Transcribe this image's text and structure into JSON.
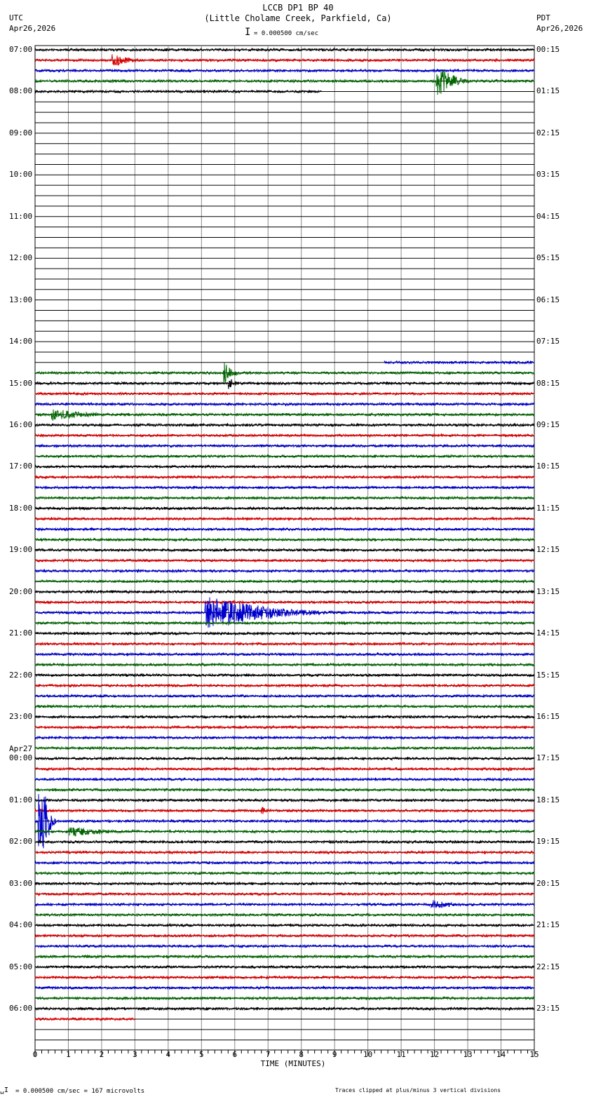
{
  "header": {
    "title": "LCCB DP1 BP 40",
    "subtitle": "(Little Cholame Creek, Parkfield, Ca)",
    "left_tz": "UTC",
    "left_date": "Apr26,2026",
    "right_tz": "PDT",
    "right_date": "Apr26,2026",
    "scale": "= 0.000500 cm/sec"
  },
  "footer": {
    "scale": "= 0.000500 cm/sec =     167 microvolts",
    "clip_note": "Traces clipped at plus/minus 3 vertical divisions"
  },
  "chart_data": {
    "type": "line",
    "title": "LCCB DP1 BP 40",
    "xlabel": "TIME (MINUTES)",
    "xlim": [
      0,
      15
    ],
    "x_ticks": [
      "0",
      "1",
      "2",
      "3",
      "4",
      "5",
      "6",
      "7",
      "8",
      "9",
      "10",
      "11",
      "12",
      "13",
      "14",
      "15"
    ],
    "rows_total": 96,
    "row_minutes": 15,
    "left_labels": [
      "07:00",
      "08:00",
      "09:00",
      "10:00",
      "11:00",
      "12:00",
      "13:00",
      "14:00",
      "15:00",
      "16:00",
      "17:00",
      "18:00",
      "19:00",
      "20:00",
      "21:00",
      "22:00",
      "23:00",
      "00:00",
      "01:00",
      "02:00",
      "03:00",
      "04:00",
      "05:00",
      "06:00"
    ],
    "left_date_change": {
      "hour_index": 17,
      "label": "Apr27"
    },
    "right_labels": [
      "00:15",
      "01:15",
      "02:15",
      "03:15",
      "04:15",
      "05:15",
      "06:15",
      "07:15",
      "08:15",
      "09:15",
      "10:15",
      "11:15",
      "12:15",
      "13:15",
      "14:15",
      "15:15",
      "16:15",
      "17:15",
      "18:15",
      "19:15",
      "20:15",
      "21:15",
      "22:15",
      "23:15"
    ],
    "colors": [
      "#000000",
      "#dd0000",
      "#0000cc",
      "#006600"
    ],
    "data_segments": [
      {
        "rows": [
          0,
          3
        ],
        "start": 0,
        "end": 15
      },
      {
        "rows": [
          4,
          4
        ],
        "start": 0,
        "end": 8.6
      },
      {
        "rows": [
          30,
          30
        ],
        "start": 10.5,
        "end": 15
      },
      {
        "rows": [
          31,
          92
        ],
        "start": 0,
        "end": 15
      },
      {
        "rows": [
          93,
          93
        ],
        "start": 0,
        "end": 3
      }
    ],
    "events": [
      {
        "row": 1,
        "minute": 2.3,
        "amplitude": 0.6,
        "duration": 1.0
      },
      {
        "row": 3,
        "minute": 12.05,
        "amplitude": 1.5,
        "duration": 1.2
      },
      {
        "row": 31,
        "minute": 5.65,
        "amplitude": 1.0,
        "duration": 0.6
      },
      {
        "row": 32,
        "minute": 5.8,
        "amplitude": 0.5,
        "duration": 0.4
      },
      {
        "row": 35,
        "minute": 0.5,
        "amplitude": 0.5,
        "duration": 2.0
      },
      {
        "row": 54,
        "minute": 5.1,
        "amplitude": 1.5,
        "duration": 4.5
      },
      {
        "row": 69,
        "minute": 14.2,
        "amplitude": 0.3,
        "duration": 0.3
      },
      {
        "row": 73,
        "minute": 6.8,
        "amplitude": 0.3,
        "duration": 0.4
      },
      {
        "row": 74,
        "minute": 0.1,
        "amplitude": 6.0,
        "duration": 0.6
      },
      {
        "row": 75,
        "minute": 1.0,
        "amplitude": 0.4,
        "duration": 2.0
      },
      {
        "row": 82,
        "minute": 11.9,
        "amplitude": 0.4,
        "duration": 1.0
      }
    ]
  }
}
